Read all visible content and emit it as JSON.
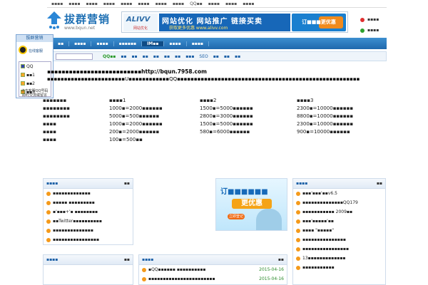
{
  "topbar": {
    "items": [
      "▪▪▪▪",
      "▪▪▪▪",
      "▪▪▪▪",
      "▪▪▪▪",
      "▪▪▪▪",
      "▪▪▪▪",
      "▪▪▪▪",
      "▪▪▪▪",
      "QQ▪▪",
      "▪▪▪▪",
      "▪▪▪▪",
      "▪▪▪▪"
    ]
  },
  "logo": {
    "name": "拔群营销",
    "url": "www.bqun.net"
  },
  "banner": {
    "brand": "ALIVV",
    "brand_sub": "网站优化",
    "headline": "网站优化 网站推广 链接买卖",
    "subline": "获取更多优惠 www.alivv.com",
    "promo": "订■■■更优惠"
  },
  "status": {
    "items": [
      "▪▪▪▪",
      "▪▪▪▪"
    ],
    "colors": [
      "#e03030",
      "#2da02d"
    ]
  },
  "nav": {
    "items": [
      "▪▪",
      "▪▪▪▪",
      "▪▪▪▪",
      "▪▪▪▪▪▪",
      "IM▪▪",
      "▪▪▪▪",
      "▪▪▪▪"
    ]
  },
  "subnav": {
    "search_placeholder": "",
    "tags": [
      "QQ▪▪",
      "▪▪",
      "▪▪",
      "▪▪",
      "▪▪",
      "▪▪",
      "▪▪",
      "▪▪▪",
      "SEO",
      "▪▪",
      "▪▪",
      "▪▪"
    ]
  },
  "widget": {
    "title": "拔群营销",
    "online": "在线客服",
    "group": "QQ",
    "members": [
      "▪▪1",
      "▪▪2",
      "▪▪3"
    ],
    "footer": [
      "点击客服QQ号码",
      "即时交流或留言"
    ]
  },
  "main": {
    "heading": "▪▪▪▪▪▪▪▪▪▪▪▪▪▪▪▪▪▪▪▪▪▪▪▪▪▪http://bqun.7958.com",
    "desc": "▪▪▪▪▪▪▪▪▪▪▪▪▪▪▪▪▪▪▪▪▪▪▪U▪▪▪▪▪▪▪▪▪▪▪▪QQ▪▪▪▪▪▪▪▪▪▪▪▪▪▪▪▪▪▪▪▪▪▪▪▪▪▪▪▪▪▪▪▪▪▪▪▪▪▪▪▪▪▪▪▪▪▪▪▪▪▪▪▪▪▪",
    "price_rows": [
      [
        "▪▪▪▪▪▪▪",
        "▪▪▪▪1",
        "▪▪▪▪2",
        "▪▪▪▪3"
      ],
      [
        "▪▪▪▪▪▪▪▪",
        "1000▪=2000▪▪▪▪▪▪",
        "1500▪=5000▪▪▪▪▪▪",
        "2300▪=10000▪▪▪▪▪▪"
      ],
      [
        "▪▪▪▪▪▪▪▪",
        "5000▪=500▪▪▪▪▪▪",
        "2800▪=3000▪▪▪▪▪▪",
        "8800▪=10000▪▪▪▪▪▪"
      ],
      [
        "▪▪▪▪",
        "1000▪=2000▪▪▪▪▪▪",
        "1500▪=5000▪▪▪▪▪▪",
        "2300▪=10000▪▪▪▪▪▪"
      ],
      [
        "▪▪▪▪",
        "200▪=2000▪▪▪▪▪▪",
        "580▪=6000▪▪▪▪▪▪",
        "900▪=10000▪▪▪▪▪▪"
      ],
      [
        "▪▪▪▪",
        "100▪=500▪▪",
        "",
        ""
      ]
    ]
  },
  "box_left": {
    "title": "▪▪▪▪",
    "more": "▪▪",
    "items": [
      "▪▪▪▪▪▪▪▪▪▪▪▪▪",
      "▪▪▪▪▪ ▪▪▪▪▪▪▪▪▪",
      "▪'▪▪▪+'▪ ▪▪▪▪▪▪▪▪",
      "▪▪Twitter▪▪▪▪▪▪▪▪▪▪",
      "▪▪▪▪▪▪▪▪▪▪▪▪▪▪",
      "▪▪▪▪▪▪▪▪▪▪▪▪▪▪▪▪"
    ]
  },
  "box_left2": {
    "title": "▪▪▪▪",
    "more": "▪▪"
  },
  "box_mid": {
    "title": "▪▪▪▪",
    "more": "▪▪",
    "items": [
      {
        "text": "▪QQ▪▪▪▪▪▪ ▪▪▪▪▪▪▪▪▪▪",
        "date": "2015-04-16"
      },
      {
        "text": "▪▪▪▪▪▪▪▪▪▪▪▪▪▪▪▪▪▪▪▪▪▪▪",
        "date": "2015-04-16"
      }
    ]
  },
  "ad": {
    "line1": "订■■■■■■",
    "line2": "更优惠",
    "button": "立即登记"
  },
  "box_right": {
    "title": "▪▪▪▪",
    "more": "▪▪",
    "items": [
      "▪▪▪'▪▪▪'▪▪v6.5",
      "▪▪▪▪▪▪▪▪▪▪▪▪▪▪QQ179",
      "▪▪▪▪▪▪▪▪▪▪▪ 2009▪▪",
      "▪▪▪'▪▪▪▪▪'▪▪",
      "▪▪▪▪ \"▪▪▪▪▪\"",
      "▪▪▪▪▪▪▪▪▪▪▪▪▪▪▪",
      "▪▪▪▪▪▪▪▪▪▪▪▪▪▪▪▪",
      "13▪▪▪▪▪▪▪▪▪▪▪▪▪",
      "▪▪▪▪▪▪▪▪▪▪▪"
    ]
  }
}
